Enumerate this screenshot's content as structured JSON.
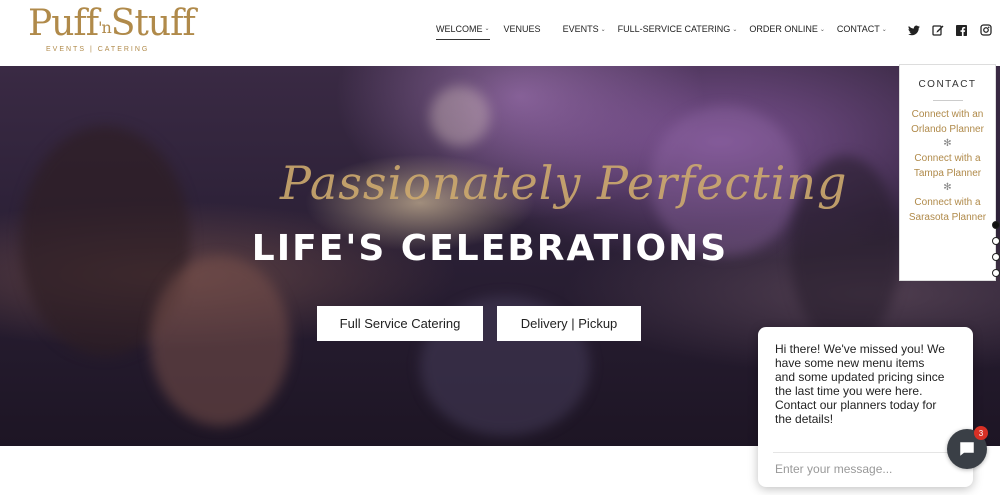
{
  "logo": {
    "main": "Puff",
    "mid": "'n",
    "end": "Stuff",
    "sub": "EVENTS | CATERING"
  },
  "nav": {
    "items": [
      {
        "label": "WELCOME",
        "caret": "⌄"
      },
      {
        "label": "VENUES",
        "caret": ""
      },
      {
        "label": "EVENTS",
        "caret": "⌄"
      },
      {
        "label": "FULL-SERVICE CATERING",
        "caret": "⌄"
      },
      {
        "label": "ORDER ONLINE",
        "caret": "⌄"
      },
      {
        "label": "CONTACT",
        "caret": "⌄"
      }
    ],
    "social": [
      "twitter-icon",
      "edit-icon",
      "facebook-icon",
      "instagram-icon"
    ]
  },
  "hero": {
    "script": "Passionately Perfecting",
    "title": "LIFE'S CELEBRATIONS",
    "btn_catering": "Full Service Catering",
    "btn_delivery": "Delivery | Pickup"
  },
  "contact": {
    "title": "CONTACT",
    "links": [
      "Connect with an Orlando Planner",
      "Connect with a Tampa Planner",
      "Connect with a Sarasota Planner"
    ],
    "separator": "✻"
  },
  "chat": {
    "message": "Hi there! We've missed you! We have some new menu items and some updated pricing since the last time you were here. Contact our planners today for the details!",
    "placeholder": "Enter your message...",
    "badge": "3"
  },
  "colors": {
    "gold": "#b08a4a",
    "chat_button": "#3a3f46",
    "badge": "#d93025"
  }
}
